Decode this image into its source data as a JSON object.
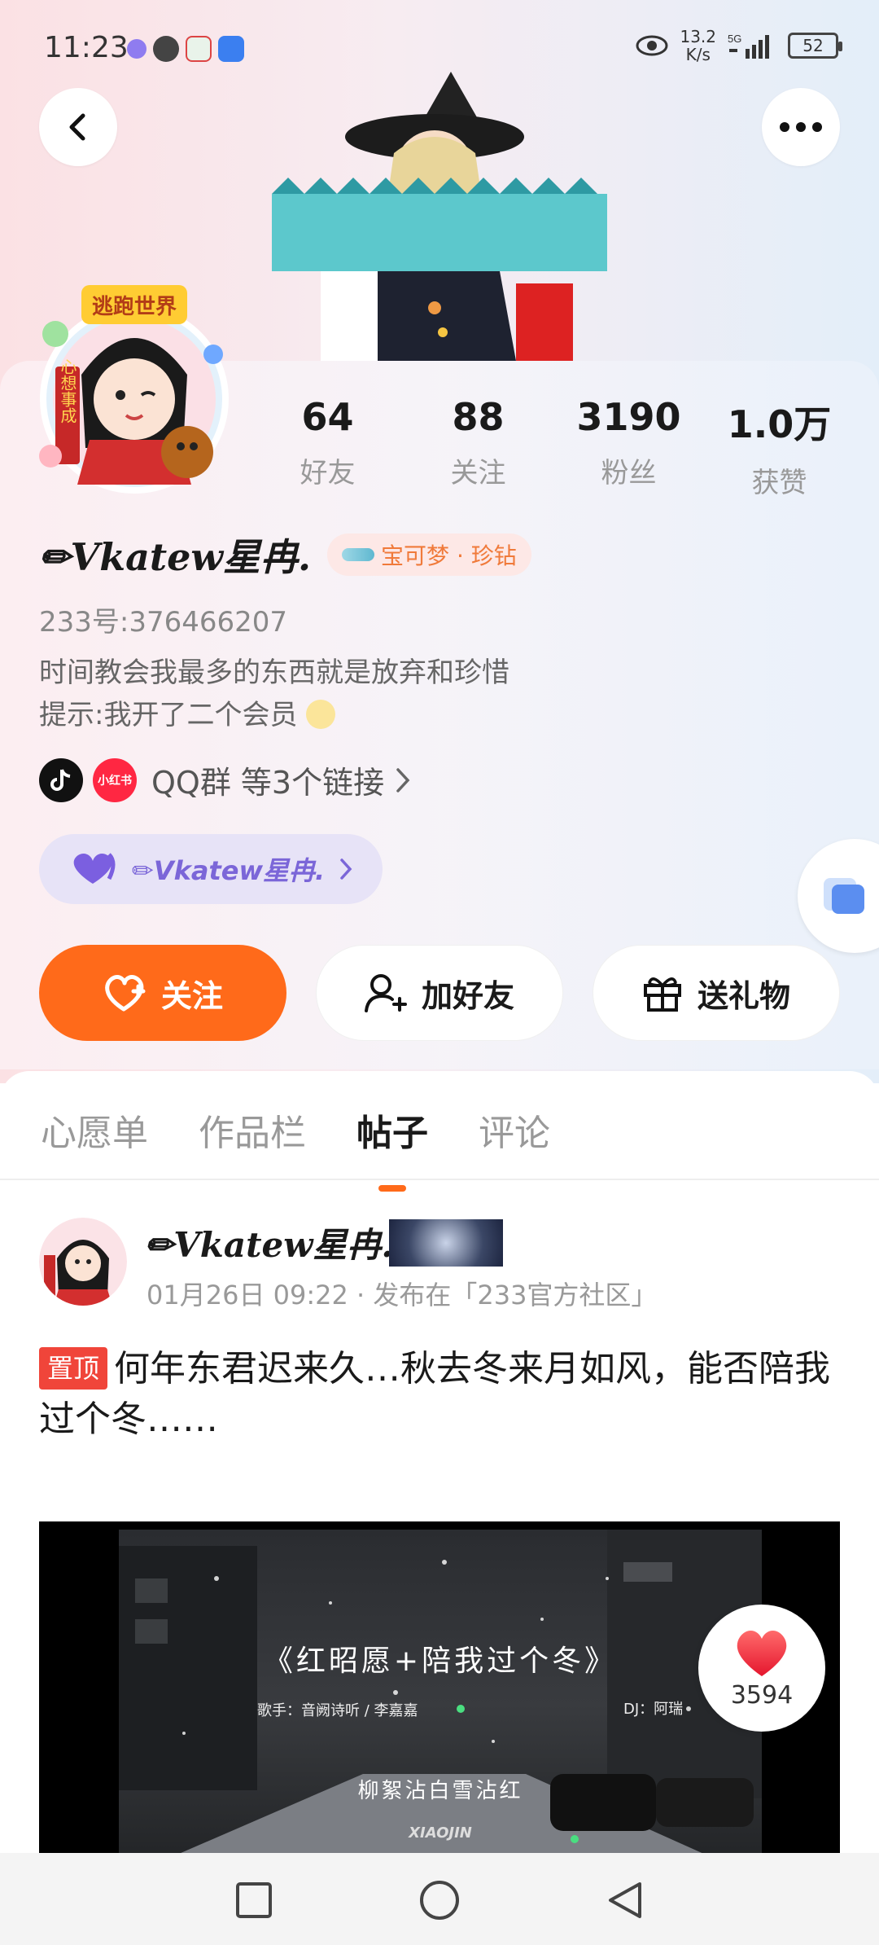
{
  "status_bar": {
    "time": "11:23",
    "net_speed_value": "13.2",
    "net_speed_unit": "K/s",
    "signal_label": "5G",
    "battery": "52"
  },
  "profile": {
    "stats": [
      {
        "value": "64",
        "label": "好友"
      },
      {
        "value": "88",
        "label": "关注"
      },
      {
        "value": "3190",
        "label": "粉丝"
      },
      {
        "value": "1.0万",
        "label": "获赞"
      }
    ],
    "username": "✏Vkatew星冉.",
    "badge": "宝可梦 · 珍钻",
    "id_text": "233号:376466207",
    "bio_line1": "时间教会我最多的东西就是放弃和珍惜",
    "bio_line2": "提示:我开了二个会员",
    "links_text": "QQ群 等3个链接",
    "xhs_label": "小红书",
    "fan_club": "✏Vkatew星冉.",
    "avatar_banner": "逃跑世界",
    "avatar_text": "心想事成"
  },
  "actions": {
    "follow": "关注",
    "add_friend": "加好友",
    "gift": "送礼物"
  },
  "tabs": [
    {
      "label": "心愿单"
    },
    {
      "label": "作品栏"
    },
    {
      "label": "帖子",
      "active": true
    },
    {
      "label": "评论"
    }
  ],
  "post": {
    "author": "✏Vkatew星冉.",
    "meta": "01月26日 09:22 · 发布在「233官方社区」",
    "pin": "置顶",
    "text": "何年东君迟来久…秋去冬来月如风，能否陪我过个冬……",
    "video": {
      "title": "《红昭愿+陪我过个冬》",
      "singer": "歌手：音阙诗听 / 李嘉嘉",
      "dj": "DJ：阿瑞",
      "lyric": "柳絮沾白雪沾红",
      "brand": "XIAOJIN"
    },
    "likes": "3594"
  },
  "colors": {
    "accent": "#ff6a1a",
    "pin": "#f0453a",
    "fan_purple": "#7b66d8"
  }
}
